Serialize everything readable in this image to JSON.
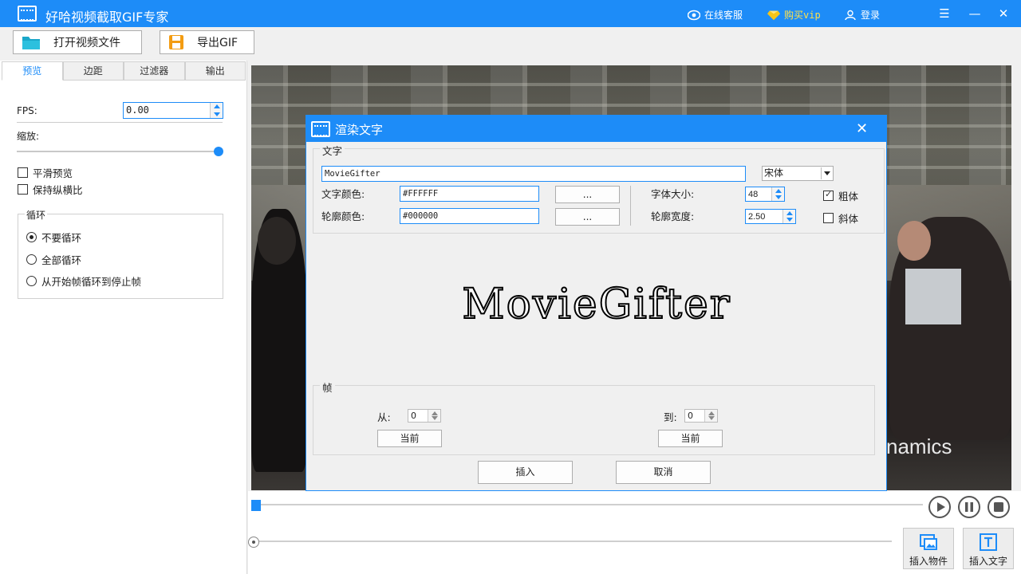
{
  "titlebar": {
    "title": "好哈视频截取GIF专家",
    "online_service": "在线客服",
    "buy_vip": "购买vip",
    "login": "登录",
    "accent": "#1d8cf8"
  },
  "toolbar": {
    "open_video": "打开视频文件",
    "export_gif": "导出GIF"
  },
  "left": {
    "tabs": [
      "预览",
      "边距",
      "过滤器",
      "输出"
    ],
    "fps_label": "FPS:",
    "fps_value": "0.00",
    "scale_label": "缩放:",
    "scale_level": 1.0,
    "smooth_preview": "平滑预览",
    "keep_ratio": "保持纵横比",
    "loop_group": "循环",
    "loop_options": [
      "不要循环",
      "全部循环",
      "从开始帧循环到停止帧"
    ],
    "loop_selected": 0
  },
  "video": {
    "overlay_text": "namics"
  },
  "dialog": {
    "title": "渲染文字",
    "text_group": "文字",
    "text_value": "MovieGifter",
    "font_name": "宋体",
    "text_color_label": "文字颜色:",
    "text_color_value": "#FFFFFF",
    "outline_color_label": "轮廓颜色:",
    "outline_color_value": "#000000",
    "picker_btn": "...",
    "font_size_label": "字体大小:",
    "font_size_value": "48",
    "outline_width_label": "轮廓宽度:",
    "outline_width_value": "2.50",
    "bold": "粗体",
    "bold_checked": true,
    "italic": "斜体",
    "italic_checked": false,
    "preview_text": "MovieGifter",
    "frame_group": "帧",
    "from_label": "从:",
    "from_value": "0",
    "to_label": "到:",
    "to_value": "0",
    "current_btn": "当前",
    "insert_btn": "插入",
    "cancel_btn": "取消"
  },
  "bottom": {
    "insert_object": "插入物件",
    "insert_text": "插入文字",
    "progress": 0.0,
    "volume": 0.0
  }
}
